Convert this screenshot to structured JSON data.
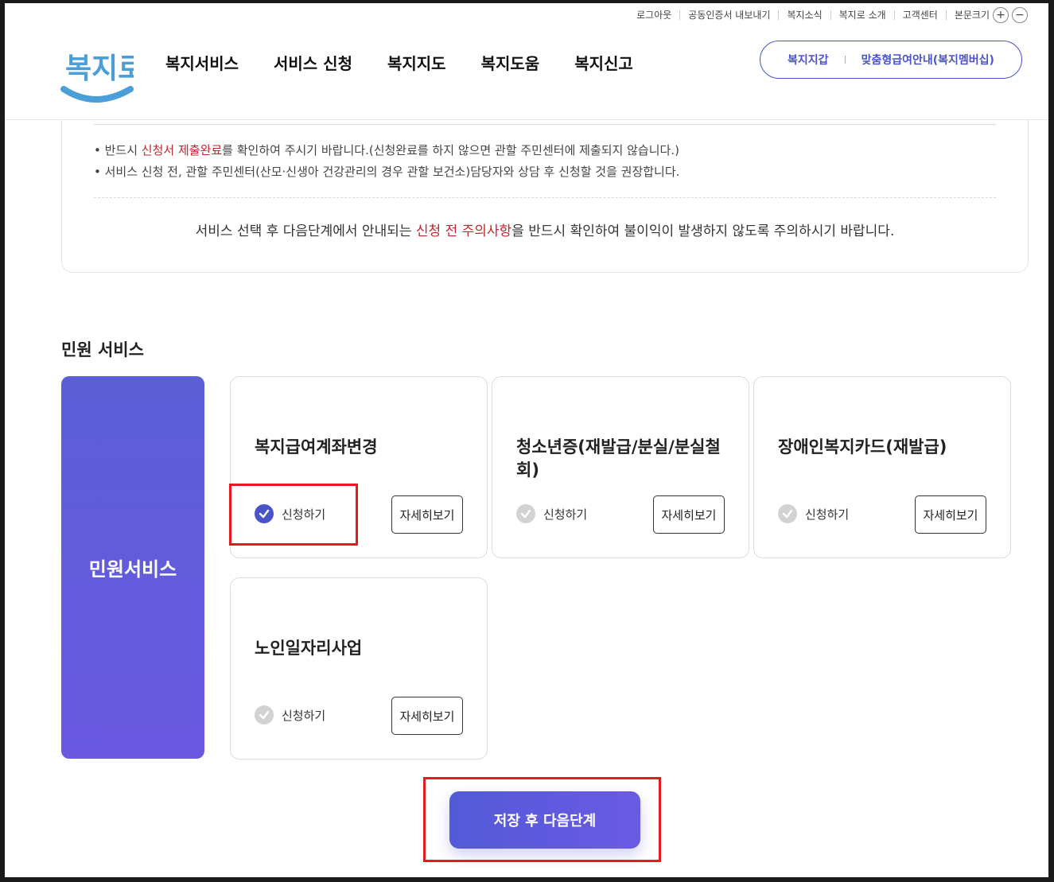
{
  "util_links": [
    "로그아웃",
    "공동인증서 내보내기",
    "복지소식",
    "복지로 소개",
    "고객센터"
  ],
  "font_size_label": "본문크기",
  "font_plus": "+",
  "font_minus": "−",
  "logo_text": "복지로",
  "gnb": [
    "복지서비스",
    "서비스 신청",
    "복지지도",
    "복지도움",
    "복지신고"
  ],
  "pill": {
    "left": "복지지갑",
    "right": "맞춤형급여안내(복지멤버십)"
  },
  "notice": {
    "line1": {
      "pre": "반드시 ",
      "highlight": "신청서 제출완료",
      "post": "를 확인하여 주시기 바랍니다.(신청완료를 하지 않으면 관할 주민센터에 제출되지 않습니다.)"
    },
    "line2": "서비스 신청 전, 관할 주민센터(산모·신생아 건강관리의 경우 관할 보건소)담당자와 상담 후 신청할 것을 권장합니다.",
    "caution": {
      "pre": "서비스 선택 후 다음단계에서 안내되는 ",
      "highlight": "신청 전 주의사항",
      "post": "을 반드시 확인하여 불이익이 발생하지 않도록 주의하시기 바랍니다."
    }
  },
  "section_title": "민원 서비스",
  "side_label": "민원서비스",
  "cards": [
    {
      "title": "복지급여계좌변경",
      "apply": "신청하기",
      "detail": "자세히보기",
      "checked": true
    },
    {
      "title": "청소년증(재발급/분실/분실철회)",
      "apply": "신청하기",
      "detail": "자세히보기",
      "checked": false
    },
    {
      "title": "장애인복지카드(재발급)",
      "apply": "신청하기",
      "detail": "자세히보기",
      "checked": false
    },
    {
      "title": "노인일자리사업",
      "apply": "신청하기",
      "detail": "자세히보기",
      "checked": false
    }
  ],
  "next_button": "저장 후 다음단계",
  "colors": {
    "accent": "#4a53c8",
    "highlight_red": "#c0262d",
    "annotation_red": "#e01b24"
  }
}
